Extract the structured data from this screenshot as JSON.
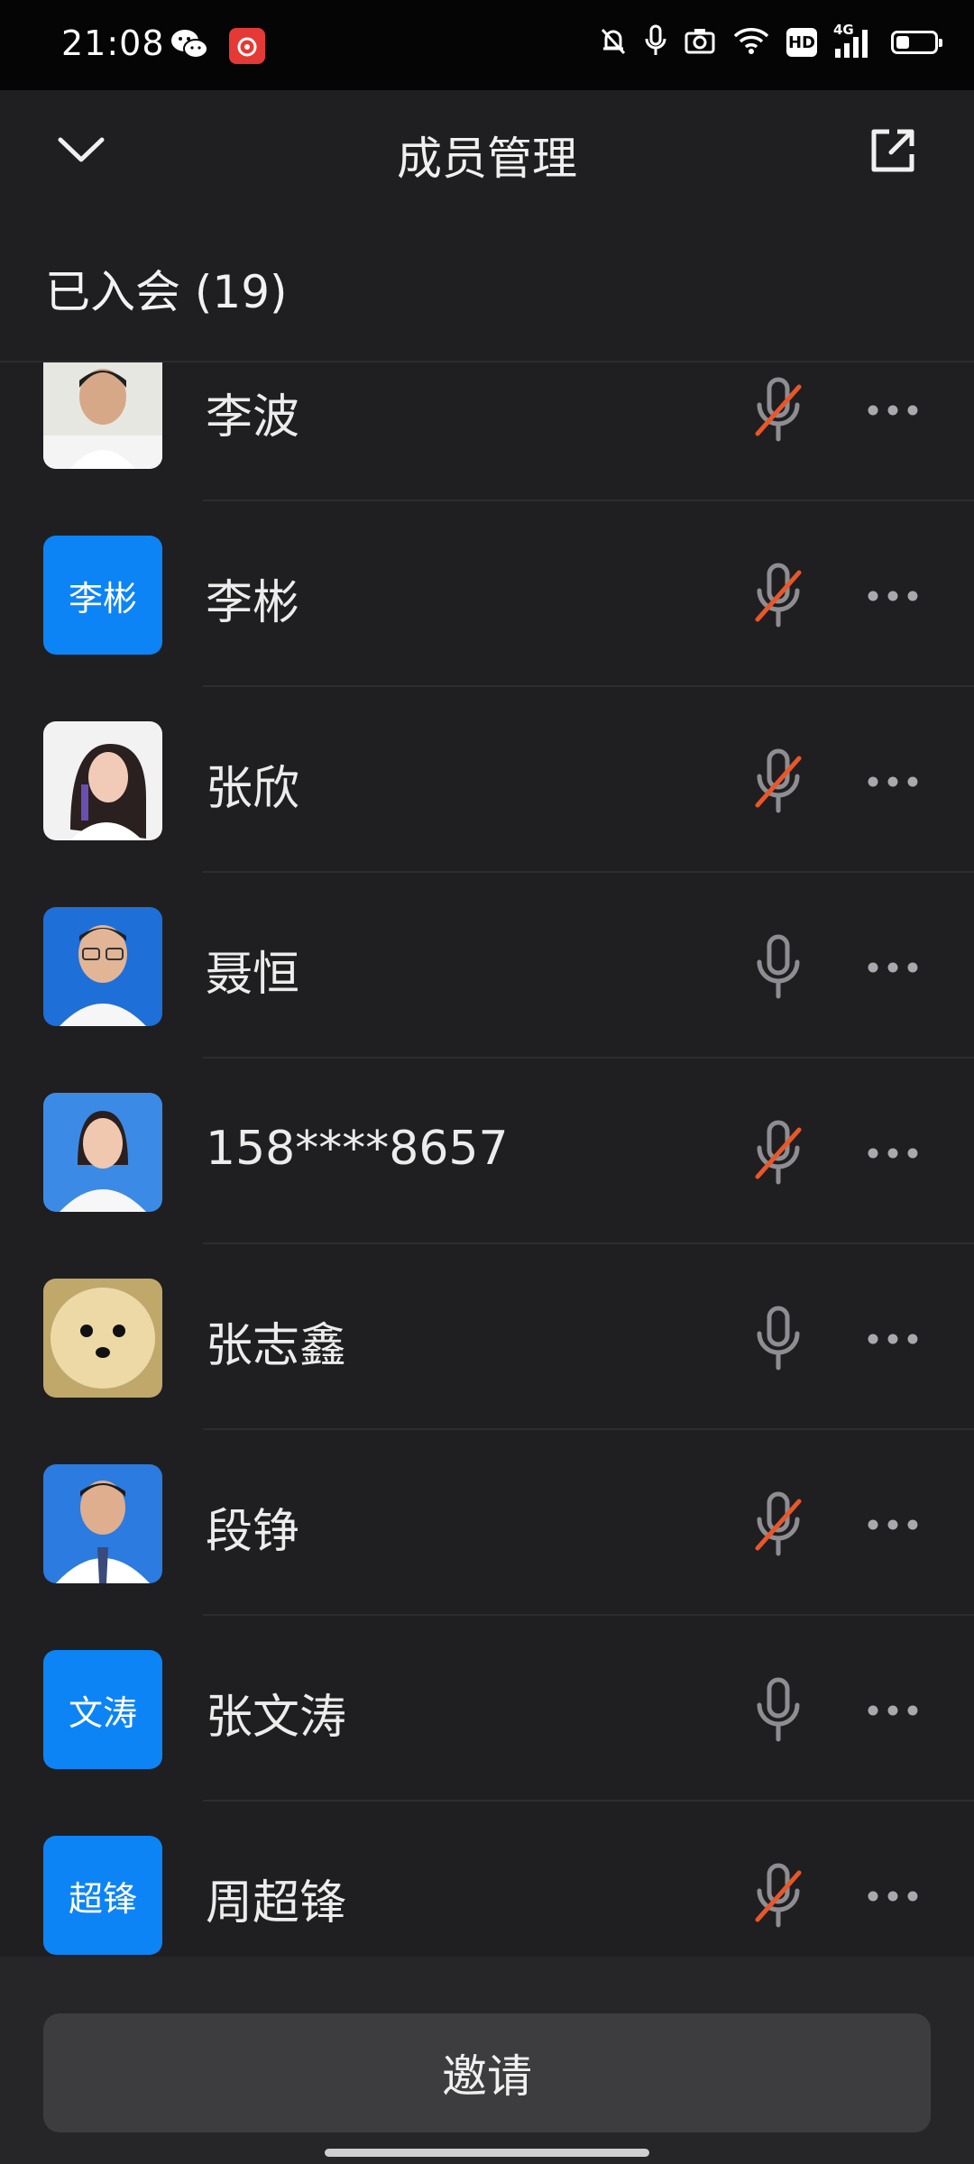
{
  "status_bar": {
    "time": "21:08",
    "left_icons": [
      "wechat-icon",
      "netease-music-icon"
    ],
    "right_icons": [
      "mute-bell-icon",
      "mic-icon",
      "camera-icon",
      "wifi-icon",
      "hd-icon",
      "4g-signal-icon",
      "battery-icon"
    ],
    "hd_label": "HD",
    "network_label": "4G",
    "battery_level": 0.35
  },
  "header": {
    "title": "成员管理",
    "collapse_icon": "chevron-down-icon",
    "popout_icon": "external-window-icon"
  },
  "section": {
    "title": "已入会 (19)"
  },
  "members": [
    {
      "name": "李波",
      "avatar": "photo",
      "muted": true
    },
    {
      "name": "李彬",
      "avatar": "text",
      "avatar_text": "李彬",
      "muted": true
    },
    {
      "name": "张欣",
      "avatar": "photo",
      "muted": true
    },
    {
      "name": "聂恒",
      "avatar": "photo",
      "muted": false
    },
    {
      "name": "158****8657",
      "avatar": "photo",
      "muted": true
    },
    {
      "name": "张志鑫",
      "avatar": "photo",
      "muted": false
    },
    {
      "name": "段铮",
      "avatar": "photo",
      "muted": true
    },
    {
      "name": "张文涛",
      "avatar": "text",
      "avatar_text": "文涛",
      "muted": false
    },
    {
      "name": "周超锋",
      "avatar": "text",
      "avatar_text": "超锋",
      "muted": true
    }
  ],
  "invite_button": {
    "label": "邀请"
  },
  "colors": {
    "background": "#1f1f21",
    "avatar_blue": "#0d84f5",
    "muted_slash": "#e8572a",
    "icon_gray": "#8e8e92"
  }
}
